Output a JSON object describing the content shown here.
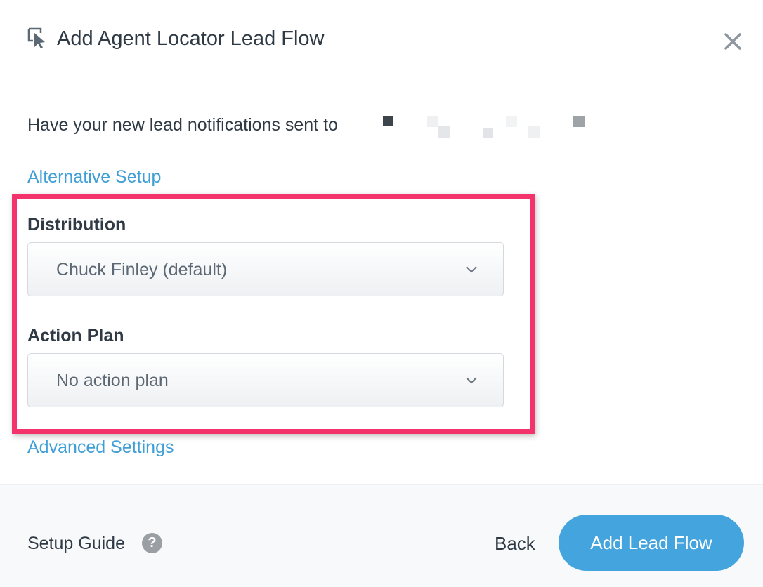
{
  "header": {
    "title": "Add Agent Locator Lead Flow",
    "icon": "cursor-click-icon",
    "close_icon": "close-icon"
  },
  "body": {
    "notification_text": "Have your new lead notifications sent to"
  },
  "links": {
    "alternative_setup": "Alternative Setup",
    "advanced_settings": "Advanced Settings"
  },
  "distribution": {
    "label": "Distribution",
    "selected": "Chuck Finley (default)"
  },
  "action_plan": {
    "label": "Action Plan",
    "selected": "No action plan"
  },
  "footer": {
    "setup_guide": "Setup Guide",
    "help_icon_glyph": "?",
    "back": "Back",
    "primary": "Add Lead Flow"
  },
  "colors": {
    "accent": "#44a4de",
    "link": "#3f9fd6",
    "highlight": "#f4336c",
    "text": "#2f3a45"
  }
}
